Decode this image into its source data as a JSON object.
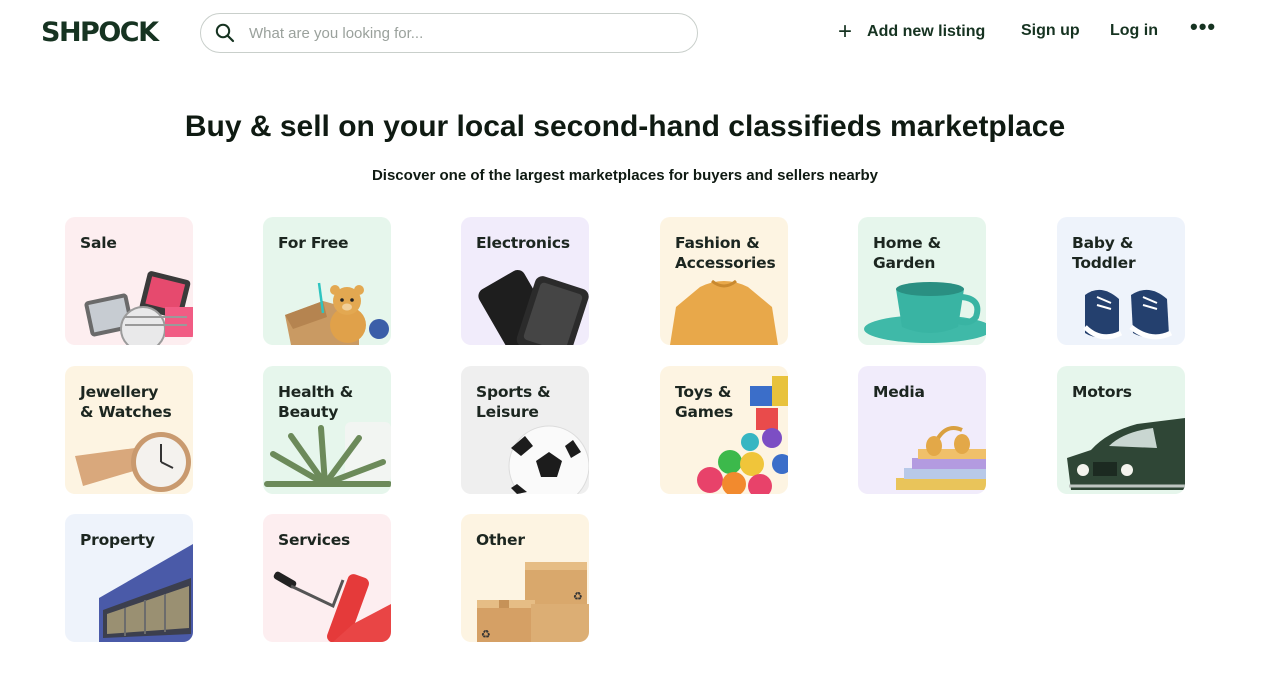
{
  "header": {
    "logo": "SHPOCK",
    "search_placeholder": "What are you looking for...",
    "add_listing": "Add new listing",
    "sign_up": "Sign up",
    "log_in": "Log in",
    "more": "•••"
  },
  "hero": {
    "title": "Buy & sell on your local second-hand classifieds marketplace",
    "subtitle": "Discover one of the largest marketplaces for buyers and sellers nearby"
  },
  "categories": [
    {
      "label": "Sale",
      "bg": "#fdeef0",
      "icon": "sale-items"
    },
    {
      "label": "For Free",
      "bg": "#e6f6ec",
      "icon": "teddy-bear"
    },
    {
      "label": "Electronics",
      "bg": "#f1ecfb",
      "icon": "smartphones"
    },
    {
      "label": "Fashion &\nAccessories",
      "bg": "#fdf4e2",
      "icon": "sweater"
    },
    {
      "label": "Home &\nGarden",
      "bg": "#e6f6ec",
      "icon": "teacup"
    },
    {
      "label": "Baby &\nToddler",
      "bg": "#eef3fb",
      "icon": "baby-shoes"
    },
    {
      "label": "Jewellery\n& Watches",
      "bg": "#fdf4e2",
      "icon": "wristwatch"
    },
    {
      "label": "Health &\nBeauty",
      "bg": "#e6f6ec",
      "icon": "aloe-plant"
    },
    {
      "label": "Sports &\nLeisure",
      "bg": "#efefef",
      "icon": "football"
    },
    {
      "label": "Toys &\nGames",
      "bg": "#fdf4e2",
      "icon": "toy-blocks"
    },
    {
      "label": "Media",
      "bg": "#f1ecfb",
      "icon": "books-headphones"
    },
    {
      "label": "Motors",
      "bg": "#e6f6ec",
      "icon": "car"
    },
    {
      "label": "Property",
      "bg": "#eef3fb",
      "icon": "building"
    },
    {
      "label": "Services",
      "bg": "#fdeef0",
      "icon": "paint-roller"
    },
    {
      "label": "Other",
      "bg": "#fdf4e2",
      "icon": "boxes"
    }
  ]
}
